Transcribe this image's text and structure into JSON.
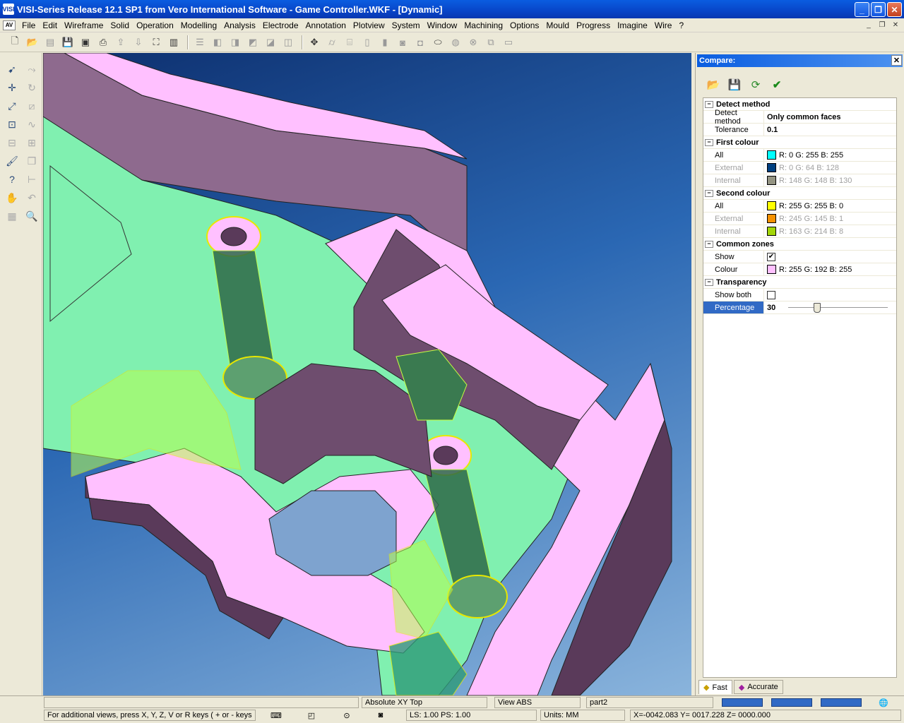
{
  "window": {
    "title": "VISI-Series Release 12.1 SP1 from Vero International Software - Game Controller.WKF - [Dynamic]",
    "app_icon_text": "VISI"
  },
  "menu": {
    "logo": "AV",
    "items": [
      "File",
      "Edit",
      "Wireframe",
      "Solid",
      "Operation",
      "Modelling",
      "Analysis",
      "Electrode",
      "Annotation",
      "Plotview",
      "System",
      "Window",
      "Machining",
      "Options",
      "Mould",
      "Progress",
      "Imagine",
      "Wire",
      "?"
    ]
  },
  "panel": {
    "title": "Compare:",
    "groups": [
      {
        "label": "Detect method",
        "rows": [
          {
            "name": "Detect method",
            "value": "Only common faces",
            "bold": true
          },
          {
            "name": "Tolerance",
            "value": "0.1",
            "bold": true
          }
        ]
      },
      {
        "label": "First colour",
        "rows": [
          {
            "name": "All",
            "value": "R: 0 G: 255 B: 255",
            "color": "#00ffff"
          },
          {
            "name": "External",
            "value": "R: 0 G: 64 B: 128",
            "color": "#004080",
            "disabled": true
          },
          {
            "name": "Internal",
            "value": "R: 148 G: 148 B: 130",
            "color": "#949482",
            "disabled": true
          }
        ]
      },
      {
        "label": "Second colour",
        "rows": [
          {
            "name": "All",
            "value": "R: 255 G: 255 B: 0",
            "color": "#ffff00"
          },
          {
            "name": "External",
            "value": "R: 245 G: 145 B: 1",
            "color": "#f59101",
            "disabled": true
          },
          {
            "name": "Internal",
            "value": "R: 163 G: 214 B: 8",
            "color": "#a3d608",
            "disabled": true
          }
        ]
      },
      {
        "label": "Common zones",
        "rows": [
          {
            "name": "Show",
            "checkbox": true,
            "checked": true
          },
          {
            "name": "Colour",
            "value": "R: 255 G: 192 B: 255",
            "color": "#ffc0ff"
          }
        ]
      },
      {
        "label": "Transparency",
        "rows": [
          {
            "name": "Show both",
            "checkbox": true,
            "checked": false
          },
          {
            "name": "Percentage",
            "value": "30",
            "slider": true,
            "slider_level": 0.3,
            "selected": true
          }
        ]
      }
    ],
    "tabs": [
      {
        "label": "Fast",
        "active": true
      },
      {
        "label": "Accurate",
        "active": false
      }
    ]
  },
  "status": {
    "view_top": "Absolute XY Top",
    "view_abs": "View ABS",
    "part": "part2",
    "hint": "For additional views, press X, Y, Z, V or R keys ( + or - keys",
    "ls_ps": "LS: 1.00 PS: 1.00",
    "units": "Units: MM",
    "coords": "X=-0042.083 Y= 0017.228 Z= 0000.000"
  },
  "colors": {
    "part_pink": "#ffc0ff",
    "part_wall": "#5a3a5a",
    "floor_green": "#80f0b0",
    "boss_green": "#2e6a48",
    "accent": "#316ac5"
  }
}
